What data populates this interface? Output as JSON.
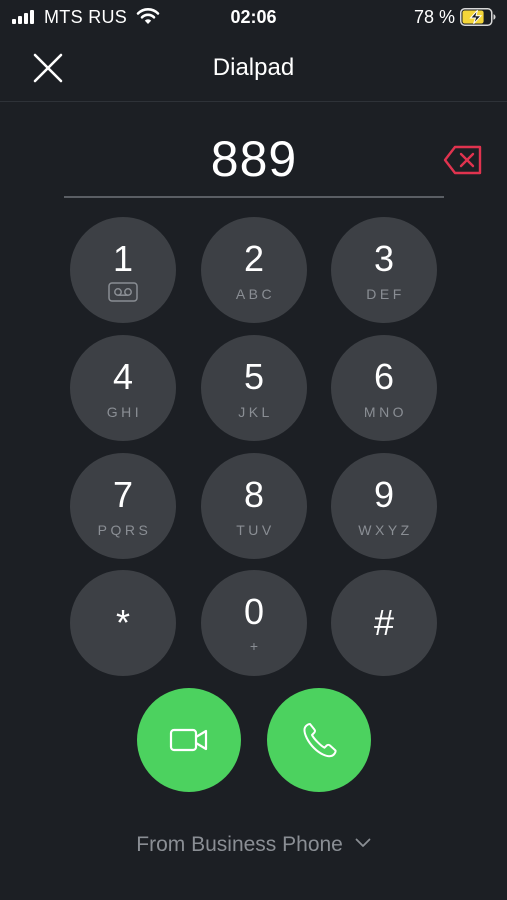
{
  "status_bar": {
    "carrier": "MTS RUS",
    "time": "02:06",
    "battery_percent": "78 %",
    "battery_level": 0.78
  },
  "header": {
    "title": "Dialpad"
  },
  "display": {
    "number": "889"
  },
  "keypad": {
    "keys": [
      {
        "digit": "1",
        "letters": "",
        "icon": "voicemail-icon"
      },
      {
        "digit": "2",
        "letters": "ABC"
      },
      {
        "digit": "3",
        "letters": "DEF"
      },
      {
        "digit": "4",
        "letters": "GHI"
      },
      {
        "digit": "5",
        "letters": "JKL"
      },
      {
        "digit": "6",
        "letters": "MNO"
      },
      {
        "digit": "7",
        "letters": "PQRS"
      },
      {
        "digit": "8",
        "letters": "TUV"
      },
      {
        "digit": "9",
        "letters": "WXYZ"
      },
      {
        "digit": "*",
        "letters": ""
      },
      {
        "digit": "0",
        "letters": "+"
      },
      {
        "digit": "#",
        "letters": ""
      }
    ]
  },
  "actions": {
    "video_call_icon": "video-camera-icon",
    "voice_call_icon": "phone-icon",
    "accent_color": "#4cd25f",
    "backspace_color": "#e0334f"
  },
  "from": {
    "label": "From Business Phone"
  }
}
